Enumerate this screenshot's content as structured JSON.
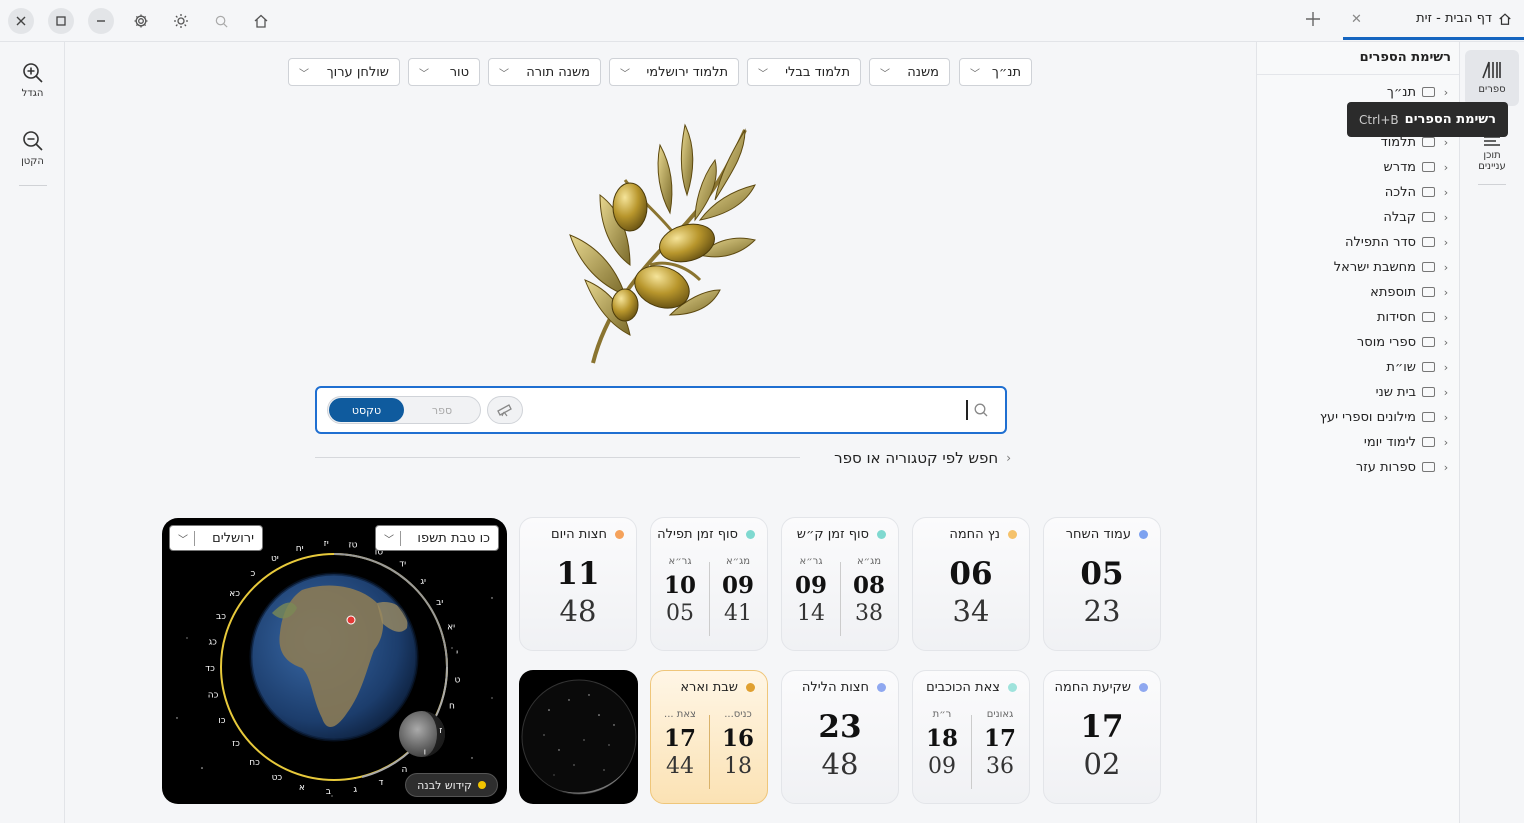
{
  "tab": {
    "title": "דף הבית - זית"
  },
  "left_toolbar": {
    "zoom_in": "הגדל",
    "zoom_out": "הקטן"
  },
  "rail": {
    "books": "ספרים",
    "toc_line1": "תוכן",
    "toc_line2": "עניינים"
  },
  "tooltip": {
    "label": "רשימת הספרים",
    "shortcut": "Ctrl+B"
  },
  "book_panel": {
    "title": "רשימת הספרים",
    "categories": [
      "תנ״ך",
      "",
      "תלמוד",
      "מדרש",
      "הלכה",
      "קבלה",
      "סדר התפילה",
      "מחשבת ישראל",
      "תוספתא",
      "חסידות",
      "ספרי מוסר",
      "שו״ת",
      "בית שני",
      "מילונים וספרי יעץ",
      "לימוד יומי",
      "ספרות עזר"
    ]
  },
  "category_buttons": [
    "תנ״ך",
    "משנה",
    "תלמוד בבלי",
    "תלמוד ירושלמי",
    "משנה תורה",
    "טור",
    "שולחן ערוך"
  ],
  "search": {
    "mode_text": "טקסט",
    "mode_book": "ספר",
    "category_search": "חפש לפי קטגוריה או ספר"
  },
  "zmanim": {
    "alot": {
      "title": "עמוד השחר",
      "h": "05",
      "m": "23",
      "color": "#7da2f0"
    },
    "netz": {
      "title": "נץ החמה",
      "h": "06",
      "m": "34",
      "color": "#f5c26b"
    },
    "shma": {
      "title": "סוף זמן ק״ש",
      "a_label": "מג״א",
      "a_h": "08",
      "a_m": "38",
      "b_label": "גר״א",
      "b_h": "09",
      "b_m": "14",
      "color": "#7fd9d0"
    },
    "tefila": {
      "title": "סוף זמן תפילה",
      "a_label": "מג״א",
      "a_h": "09",
      "a_m": "41",
      "b_label": "גר״א",
      "b_h": "10",
      "b_m": "05",
      "color": "#7fd9d0"
    },
    "chatzot": {
      "title": "חצות היום",
      "h": "11",
      "m": "48",
      "color": "#f5a25b"
    },
    "shkia": {
      "title": "שקיעת החמה",
      "h": "17",
      "m": "02",
      "color": "#8fa8f0"
    },
    "tzet": {
      "title": "צאת הכוכבים",
      "a_label": "גאונים",
      "a_h": "17",
      "a_m": "36",
      "b_label": "ר״ת",
      "b_h": "18",
      "b_m": "09",
      "color": "#9fe3dc"
    },
    "chatzot_layla": {
      "title": "חצות הלילה",
      "h": "23",
      "m": "48",
      "color": "#8fa8f0"
    },
    "shabbat": {
      "title": "שבת וארא",
      "a_label": "כניס...",
      "a_h": "16",
      "a_m": "18",
      "b_label": "צאת ...",
      "b_h": "17",
      "b_m": "44",
      "color": "#e0a030"
    }
  },
  "earth": {
    "date": "כו טבת תשפו",
    "city": "ירושלים",
    "kiddush": "קידוש לבנה",
    "ring_days": [
      "א",
      "ב",
      "ג",
      "ד",
      "ה",
      "ו",
      "ז",
      "ח",
      "ט",
      "י",
      "יא",
      "יב",
      "יג",
      "יד",
      "טו",
      "טז",
      "יז",
      "יח",
      "יט",
      "כ",
      "כא",
      "כב",
      "כג",
      "כד",
      "כה",
      "כו",
      "כז",
      "כח",
      "כט"
    ]
  }
}
